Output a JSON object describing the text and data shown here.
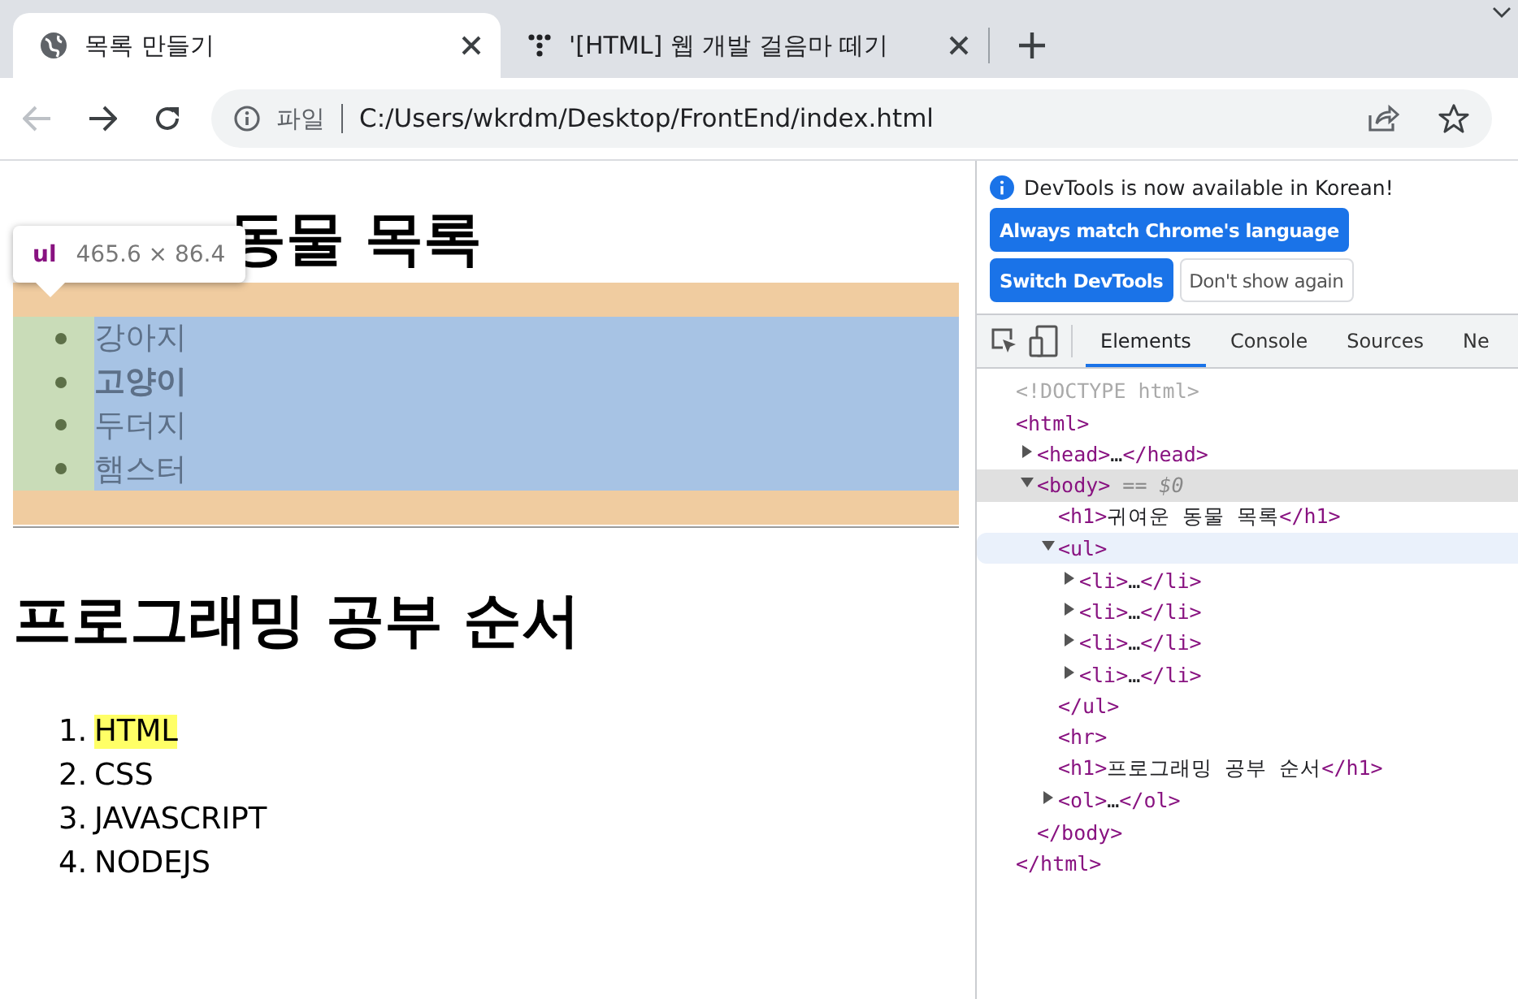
{
  "tabs": [
    {
      "title": "목록 만들기",
      "selected": true
    },
    {
      "title": "'[HTML] 웹 개발 걸음마 떼기",
      "selected": false
    }
  ],
  "address": {
    "scheme_label": "파일",
    "url": "C:/Users/wkrdm/Desktop/FrontEnd/index.html"
  },
  "page": {
    "heading_visible": "동물 목록",
    "inspect_tooltip": {
      "tag": "ul",
      "size": "465.6 × 86.4"
    },
    "animals": [
      {
        "text": "강아지",
        "bold": false
      },
      {
        "text": "고양이",
        "bold": true
      },
      {
        "text": "두더지",
        "bold": false
      },
      {
        "text": "햄스터",
        "bold": false
      }
    ],
    "heading2": "프로그래밍 공부 순서",
    "steps": [
      {
        "number": "1.",
        "text": "HTML",
        "highlighted": true
      },
      {
        "number": "2.",
        "text": "CSS",
        "highlighted": false
      },
      {
        "number": "3.",
        "text": "JAVASCRIPT",
        "highlighted": false
      },
      {
        "number": "4.",
        "text": "NODEJS",
        "highlighted": false
      }
    ]
  },
  "devtools": {
    "notice": "DevTools is now available in Korean!",
    "buttons": [
      {
        "label": "Always match Chrome's language",
        "kind": "primary"
      },
      {
        "label": "Switch DevTools",
        "kind": "primary"
      },
      {
        "label": "Don't show again",
        "kind": "secondary"
      }
    ],
    "tabs": [
      {
        "label": "Elements",
        "selected": true
      },
      {
        "label": "Console",
        "selected": false
      },
      {
        "label": "Sources",
        "selected": false
      },
      {
        "label": "Ne",
        "selected": false
      }
    ],
    "tree": [
      {
        "parts": [
          {
            "kind": "doctype",
            "text": "<!DOCTYPE html>"
          }
        ],
        "selected": false,
        "hovered": false
      },
      {
        "parts": [
          {
            "kind": "tag",
            "text": "<html>"
          }
        ],
        "selected": false,
        "hovered": false,
        "closing": [
          {
            "kind": "tag",
            "text": "</html>"
          }
        ],
        "children": [
          {
            "parts": [
              {
                "kind": "tag",
                "text": "<head>"
              },
              {
                "kind": "text",
                "text": "…"
              },
              {
                "kind": "tag",
                "text": "</head>"
              }
            ],
            "expanded": false,
            "selected": false,
            "hovered": false
          },
          {
            "parts": [
              {
                "kind": "tag",
                "text": "<body>"
              },
              {
                "kind": "ref",
                "text": " == $0"
              }
            ],
            "expanded": true,
            "selected": true,
            "hovered": false,
            "closing": [
              {
                "kind": "tag",
                "text": "</body>"
              }
            ],
            "children": [
              {
                "parts": [
                  {
                    "kind": "tag",
                    "text": "<h1>"
                  },
                  {
                    "kind": "text",
                    "text": "귀여운 동물 목록"
                  },
                  {
                    "kind": "tag",
                    "text": "</h1>"
                  }
                ],
                "selected": false,
                "hovered": false
              },
              {
                "parts": [
                  {
                    "kind": "tag",
                    "text": "<ul>"
                  }
                ],
                "expanded": true,
                "selected": false,
                "hovered": true,
                "closing": [
                  {
                    "kind": "tag",
                    "text": "</ul>"
                  }
                ],
                "children": [
                  {
                    "parts": [
                      {
                        "kind": "tag",
                        "text": "<li>"
                      },
                      {
                        "kind": "text",
                        "text": "…"
                      },
                      {
                        "kind": "tag",
                        "text": "</li>"
                      }
                    ],
                    "expanded": false,
                    "selected": false,
                    "hovered": false
                  },
                  {
                    "parts": [
                      {
                        "kind": "tag",
                        "text": "<li>"
                      },
                      {
                        "kind": "text",
                        "text": "…"
                      },
                      {
                        "kind": "tag",
                        "text": "</li>"
                      }
                    ],
                    "expanded": false,
                    "selected": false,
                    "hovered": false
                  },
                  {
                    "parts": [
                      {
                        "kind": "tag",
                        "text": "<li>"
                      },
                      {
                        "kind": "text",
                        "text": "…"
                      },
                      {
                        "kind": "tag",
                        "text": "</li>"
                      }
                    ],
                    "expanded": false,
                    "selected": false,
                    "hovered": false
                  },
                  {
                    "parts": [
                      {
                        "kind": "tag",
                        "text": "<li>"
                      },
                      {
                        "kind": "text",
                        "text": "…"
                      },
                      {
                        "kind": "tag",
                        "text": "</li>"
                      }
                    ],
                    "expanded": false,
                    "selected": false,
                    "hovered": false
                  }
                ]
              },
              {
                "parts": [
                  {
                    "kind": "tag",
                    "text": "<hr>"
                  }
                ],
                "selected": false,
                "hovered": false
              },
              {
                "parts": [
                  {
                    "kind": "tag",
                    "text": "<h1>"
                  },
                  {
                    "kind": "text",
                    "text": "프로그래밍 공부 순서"
                  },
                  {
                    "kind": "tag",
                    "text": "</h1>"
                  }
                ],
                "selected": false,
                "hovered": false
              },
              {
                "parts": [
                  {
                    "kind": "tag",
                    "text": "<ol>"
                  },
                  {
                    "kind": "text",
                    "text": "…"
                  },
                  {
                    "kind": "tag",
                    "text": "</ol>"
                  }
                ],
                "expanded": false,
                "selected": false,
                "hovered": false
              }
            ]
          }
        ]
      }
    ]
  }
}
